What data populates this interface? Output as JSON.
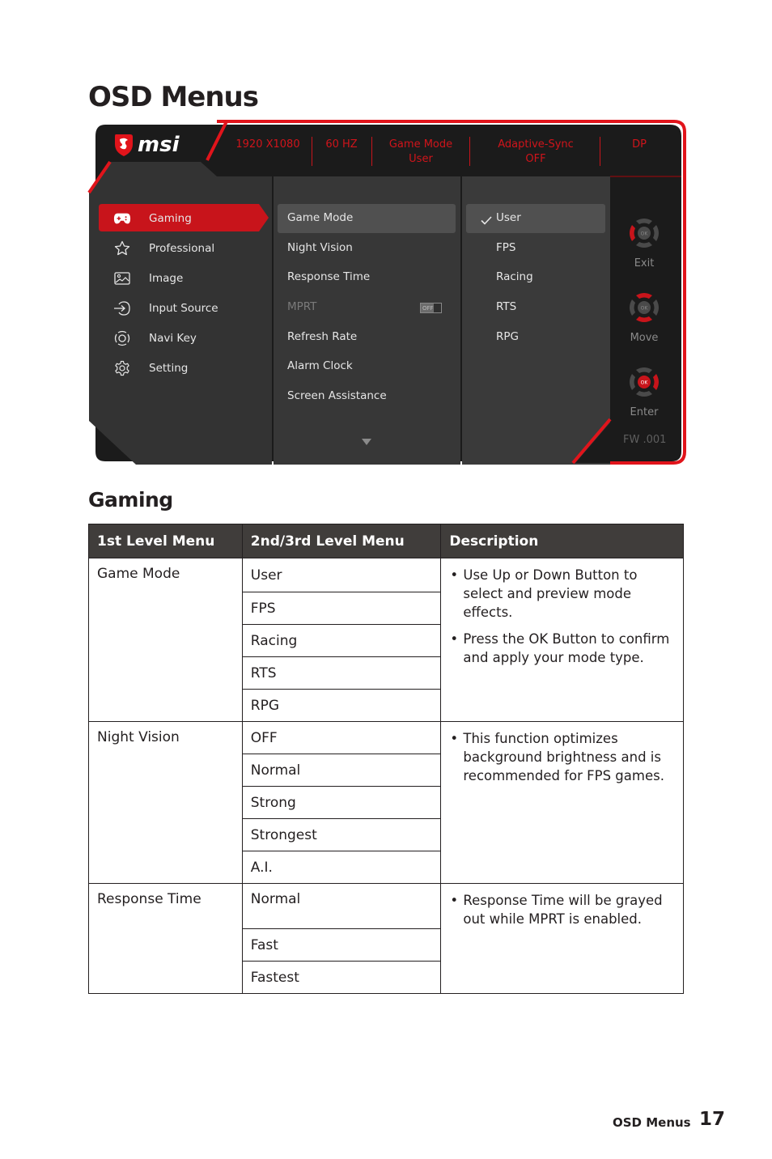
{
  "page": {
    "title": "OSD Menus",
    "section_title": "Gaming",
    "footer_label": "OSD Menus",
    "page_number": "17"
  },
  "osd": {
    "brand": "msi",
    "accent_color": "#d0141b",
    "status_bar": [
      {
        "line1": "1920 X1080",
        "line2": ""
      },
      {
        "line1": "60 HZ",
        "line2": ""
      },
      {
        "line1": "Game Mode",
        "line2": "User"
      },
      {
        "line1": "Adaptive-Sync",
        "line2": "OFF"
      },
      {
        "line1": "DP",
        "line2": ""
      }
    ],
    "main_menu": [
      {
        "label": "Gaming",
        "icon": "gamepad-icon",
        "selected": true
      },
      {
        "label": "Professional",
        "icon": "star-icon",
        "selected": false
      },
      {
        "label": "Image",
        "icon": "image-icon",
        "selected": false
      },
      {
        "label": "Input Source",
        "icon": "input-source-icon",
        "selected": false
      },
      {
        "label": "Navi Key",
        "icon": "navi-key-icon",
        "selected": false
      },
      {
        "label": "Setting",
        "icon": "gear-icon",
        "selected": false
      }
    ],
    "sub_menu": [
      {
        "label": "Game Mode",
        "selected": true,
        "disabled": false
      },
      {
        "label": "Night Vision",
        "selected": false,
        "disabled": false
      },
      {
        "label": "Response Time",
        "selected": false,
        "disabled": false
      },
      {
        "label": "MPRT",
        "selected": false,
        "disabled": true,
        "toggle": "OFF"
      },
      {
        "label": "Refresh Rate",
        "selected": false,
        "disabled": false
      },
      {
        "label": "Alarm Clock",
        "selected": false,
        "disabled": false
      },
      {
        "label": "Screen Assistance",
        "selected": false,
        "disabled": false
      }
    ],
    "options": [
      {
        "label": "User",
        "checked": true
      },
      {
        "label": "FPS",
        "checked": false
      },
      {
        "label": "Racing",
        "checked": false
      },
      {
        "label": "RTS",
        "checked": false
      },
      {
        "label": "RPG",
        "checked": false
      }
    ],
    "nav_keys": [
      {
        "label": "Exit",
        "active": "left"
      },
      {
        "label": "Move",
        "active": "updown"
      },
      {
        "label": "Enter",
        "active": "ok-right"
      }
    ],
    "ok_label": "OK",
    "firmware": "FW .001"
  },
  "table": {
    "headers": [
      "1st Level Menu",
      "2nd/3rd Level Menu",
      "Description"
    ],
    "rows": [
      {
        "menu": "Game Mode",
        "options": [
          "User",
          "FPS",
          "Racing",
          "RTS",
          "RPG"
        ],
        "description": [
          "Use Up or Down Button to select and preview mode effects.",
          "Press the OK Button to confirm and apply your mode type."
        ]
      },
      {
        "menu": "Night Vision",
        "options": [
          "OFF",
          "Normal",
          "Strong",
          "Strongest",
          "A.I."
        ],
        "description": [
          "This function optimizes background brightness and is recommended for FPS games."
        ]
      },
      {
        "menu": "Response Time",
        "options": [
          "Normal",
          "Fast",
          "Fastest"
        ],
        "description": [
          "Response Time will be grayed out while MPRT is enabled."
        ]
      }
    ]
  }
}
